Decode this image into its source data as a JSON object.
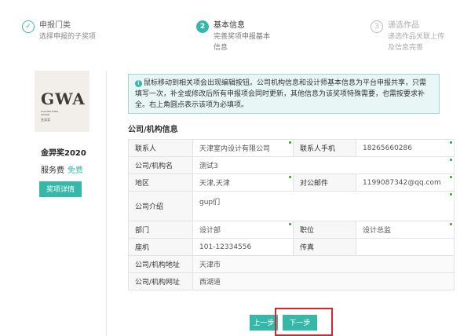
{
  "steps": [
    {
      "number": "✓",
      "title": "申报门类",
      "desc": [
        "选择申报的子奖项"
      ]
    },
    {
      "number": "2",
      "title": "基本信息",
      "desc": [
        "完善奖项申报基本",
        "信息"
      ]
    },
    {
      "number": "3",
      "title": "递选作品",
      "desc": [
        "递选作品关联上传",
        "及信息完善"
      ]
    }
  ],
  "award": {
    "logo_text": "GWA",
    "logo_sub1": "GOLDEN WING",
    "logo_sub2": "AWARD",
    "logo_cn": "金羿奖",
    "name": "金羿奖2020",
    "fee_label": "服务费",
    "fee_value": "免费",
    "detail_button": "奖项详情"
  },
  "notice": {
    "text": "鼠标移动到相关项会出现编辑按钮。公司机构信息和设计师基本信息为平台申报共享，只需填写一次，补全或修改后所有申报项会同时更新，其他信息为该奖项特殊需要，也需按要求补全。右上角圆点表示该项为必填项。"
  },
  "section_title": "公司/机构信息",
  "form": {
    "contact_label": "联系人",
    "contact_value": "天津室内设计有限公司",
    "phone_label": "联系人手机",
    "phone_value": "18265660286",
    "org_label": "公司/机构名",
    "org_value": "测试3",
    "region_label": "地区",
    "region_value": "天津,天津",
    "email_label": "对公邮件",
    "email_value": "1199087342@qq.com",
    "intro_label": "公司介绍",
    "intro_value": "gup们",
    "dept_label": "部门",
    "dept_value": "设计部",
    "position_label": "职位",
    "position_value": "设计总监",
    "landline_label": "座机",
    "landline_value": "101-12334556",
    "fax_label": "传真",
    "fax_value": "",
    "address_label": "公司/机构地址",
    "address_value": "天津市",
    "website_label": "公司/机构网址",
    "website_value": "西湖道"
  },
  "buttons": {
    "prev": "上一步",
    "next": "下一步"
  },
  "colors": {
    "accent": "#36b8a8",
    "highlight": "#d9232e",
    "required_dot": "#2ca02c"
  }
}
